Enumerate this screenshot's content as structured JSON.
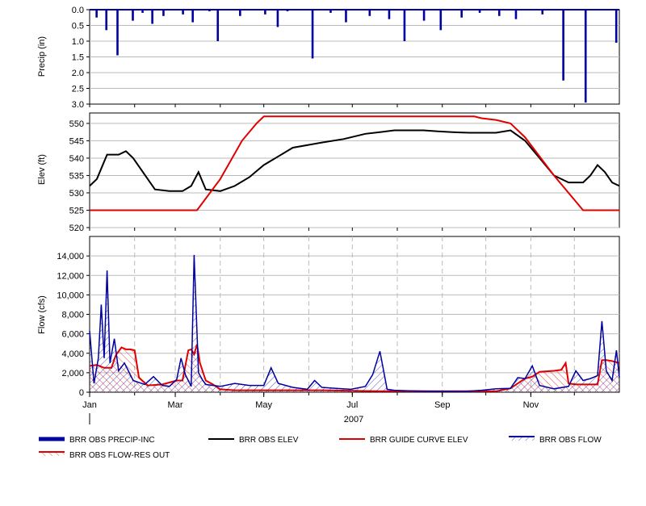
{
  "chart_data": [
    {
      "type": "bar",
      "ylabel": "Precip (in)",
      "ylim": [
        0,
        3.0
      ],
      "inverted": true,
      "yticks": [
        "0.0",
        "0.5",
        "1.0",
        "1.5",
        "2.0",
        "2.5",
        "3.0"
      ],
      "series": [
        {
          "name": "BRR OBS PRECIP-INC",
          "color": "#0000a0",
          "x": [
            0.5,
            1.2,
            2.0,
            3.1,
            3.8,
            4.5,
            5.3,
            6.7,
            7.4,
            8.6,
            9.2,
            10.8,
            12.6,
            13.5,
            14.2,
            16.0,
            17.3,
            18.4,
            20.1,
            21.5,
            22.6,
            24.0,
            25.2,
            26.7,
            28.0,
            29.4,
            30.6,
            32.5,
            34.0,
            35.6,
            37.8
          ],
          "values": [
            0.25,
            0.65,
            1.45,
            0.35,
            0.1,
            0.45,
            0.2,
            0.15,
            0.4,
            0.05,
            1.0,
            0.2,
            0.15,
            0.55,
            0.05,
            1.55,
            0.1,
            0.4,
            0.2,
            0.3,
            1.0,
            0.35,
            0.65,
            0.25,
            0.1,
            0.2,
            0.3,
            0.15,
            2.25,
            2.95,
            1.05
          ]
        }
      ]
    },
    {
      "type": "line",
      "ylabel": "Elev (ft)",
      "ylim": [
        520,
        553
      ],
      "yticks": [
        "520",
        "525",
        "530",
        "535",
        "540",
        "545",
        "550"
      ],
      "series": [
        {
          "name": "BRR OBS ELEV",
          "color": "#000000",
          "x": [
            0,
            5,
            12,
            20,
            25,
            30,
            45,
            55,
            64,
            70,
            75,
            80,
            90,
            100,
            110,
            120,
            130,
            140,
            160,
            175,
            190,
            200,
            210,
            215,
            220,
            230,
            240,
            250,
            255,
            262,
            270,
            280,
            290,
            300,
            310,
            320,
            330,
            340,
            345,
            350,
            355,
            360,
            365
          ],
          "y": [
            532,
            534,
            541,
            541,
            542,
            540,
            531,
            530.5,
            530.5,
            532,
            536,
            531,
            530.5,
            532,
            534.5,
            538,
            540.5,
            543,
            544.5,
            545.5,
            547,
            547.5,
            548,
            548,
            548,
            548,
            547.7,
            547.5,
            547.4,
            547.3,
            547.3,
            547.3,
            548,
            545,
            540,
            535,
            533,
            533,
            535,
            538,
            536,
            533,
            532
          ]
        },
        {
          "name": "BRR GUIDE CURVE ELEV",
          "color": "#e00000",
          "x": [
            0,
            74,
            90,
            105,
            115,
            120,
            155,
            190,
            230,
            255,
            265,
            270,
            280,
            290,
            300,
            320,
            340,
            365
          ],
          "y": [
            525,
            525,
            534,
            545,
            550,
            552,
            552,
            552,
            552,
            552,
            552,
            551.5,
            551,
            550,
            546,
            535,
            525,
            525
          ]
        }
      ]
    },
    {
      "type": "area",
      "ylabel": "Flow (cfs)",
      "ylim": [
        0,
        16000
      ],
      "yticks": [
        "0",
        "2,000",
        "4,000",
        "6,000",
        "8,000",
        "10,000",
        "12,000",
        "14,000"
      ],
      "xticks": [
        "Jan",
        "Mar",
        "May",
        "Jul",
        "Sep",
        "Nov"
      ],
      "xlabel": "2007",
      "series": [
        {
          "name": "BRR OBS FLOW",
          "color": "#0000a0",
          "x": [
            0,
            3,
            6,
            8,
            10,
            12,
            14,
            17,
            20,
            24,
            30,
            38,
            44,
            50,
            55,
            60,
            63,
            66,
            70,
            72,
            75,
            78,
            80,
            85,
            90,
            100,
            110,
            120,
            125,
            130,
            140,
            150,
            155,
            160,
            170,
            180,
            190,
            195,
            200,
            205,
            210,
            220,
            230,
            240,
            250,
            260,
            270,
            280,
            290,
            295,
            300,
            305,
            310,
            320,
            330,
            335,
            340,
            345,
            350,
            353,
            356,
            360,
            363,
            365
          ],
          "y": [
            6300,
            900,
            3500,
            9000,
            3500,
            12500,
            3000,
            5500,
            2200,
            3000,
            1200,
            800,
            1600,
            700,
            600,
            1300,
            3500,
            1800,
            600,
            14100,
            2000,
            1200,
            800,
            700,
            600,
            900,
            700,
            700,
            2500,
            900,
            500,
            300,
            1200,
            500,
            400,
            300,
            600,
            1800,
            4200,
            300,
            200,
            150,
            120,
            100,
            90,
            100,
            200,
            350,
            400,
            1500,
            1400,
            2700,
            700,
            350,
            600,
            2200,
            1200,
            1400,
            1700,
            7300,
            2200,
            1200,
            4300,
            1500
          ]
        },
        {
          "name": "BRR OBS FLOW-RES OUT",
          "color": "#e00000",
          "x": [
            0,
            5,
            10,
            15,
            18,
            22,
            25,
            28,
            31,
            34,
            40,
            50,
            60,
            64,
            68,
            70,
            72,
            74,
            76,
            80,
            85,
            90,
            100,
            110,
            140,
            160,
            200,
            220,
            240,
            260,
            280,
            290,
            295,
            300,
            305,
            310,
            320,
            325,
            328,
            330,
            335,
            340,
            345,
            350,
            353,
            356,
            360,
            365
          ],
          "y": [
            2700,
            2800,
            2500,
            2500,
            3800,
            4600,
            4400,
            4400,
            4300,
            1500,
            700,
            800,
            1200,
            1200,
            4300,
            4400,
            3900,
            4900,
            3000,
            1200,
            800,
            300,
            200,
            200,
            200,
            200,
            100,
            100,
            100,
            100,
            100,
            400,
            900,
            1400,
            1600,
            2100,
            2200,
            2300,
            3000,
            900,
            800,
            800,
            800,
            800,
            3300,
            3300,
            3200,
            3000
          ]
        }
      ]
    }
  ]
}
